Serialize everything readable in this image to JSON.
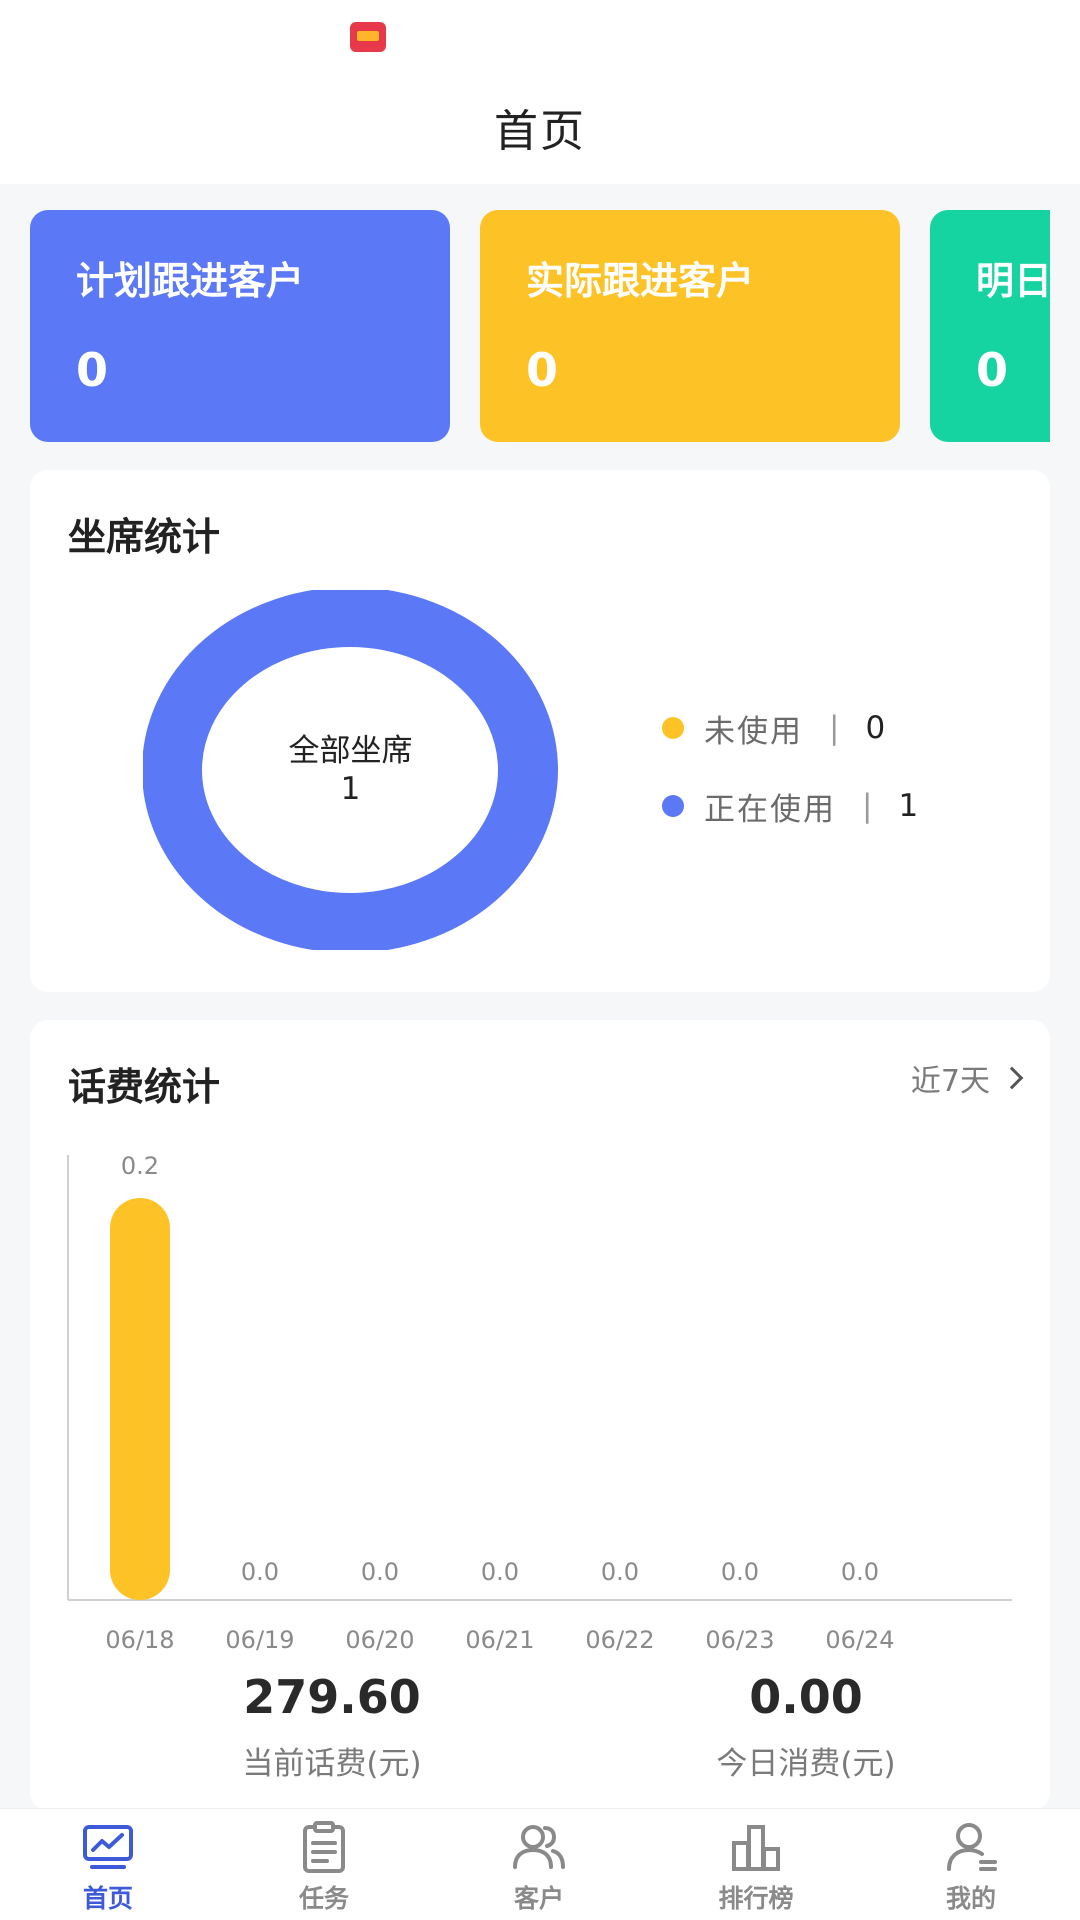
{
  "header": {
    "title": "首页"
  },
  "summary_cards": [
    {
      "label": "计划跟进客户",
      "value": "0",
      "color": "#5b78f6"
    },
    {
      "label": "实际跟进客户",
      "value": "0",
      "color": "#fdc226"
    },
    {
      "label": "明日",
      "value": "0",
      "color": "#16d3a2"
    }
  ],
  "seats": {
    "title": "坐席统计",
    "center_label": "全部坐席",
    "center_value": "1",
    "legend": [
      {
        "name": "未使用",
        "sep": "|",
        "value": "0",
        "color": "#fdc226"
      },
      {
        "name": "正在使用",
        "sep": "|",
        "value": "1",
        "color": "#5b78f6"
      }
    ]
  },
  "fees": {
    "title": "话费统计",
    "range_label": "近7天",
    "balance_value": "279.60",
    "balance_label": "当前话费(元)",
    "today_value": "0.00",
    "today_label": "今日消费(元)"
  },
  "chart_data": {
    "type": "bar",
    "categories": [
      "06/18",
      "06/19",
      "06/20",
      "06/21",
      "06/22",
      "06/23",
      "06/24"
    ],
    "values": [
      0.2,
      0.0,
      0.0,
      0.0,
      0.0,
      0.0,
      0.0
    ],
    "data_labels": [
      "0.2",
      "0.0",
      "0.0",
      "0.0",
      "0.0",
      "0.0",
      "0.0"
    ],
    "bar_color": "#fdc226",
    "ylim": [
      0,
      0.2
    ],
    "grid": false
  },
  "tabs": [
    {
      "label": "首页",
      "icon": "home-chart-icon",
      "active": true
    },
    {
      "label": "任务",
      "icon": "clipboard-icon",
      "active": false
    },
    {
      "label": "客户",
      "icon": "users-icon",
      "active": false
    },
    {
      "label": "排行榜",
      "icon": "ranking-icon",
      "active": false
    },
    {
      "label": "我的",
      "icon": "user-icon",
      "active": false
    }
  ],
  "colors": {
    "accent": "#3d5bd9",
    "inactive": "#8a8a8a"
  }
}
